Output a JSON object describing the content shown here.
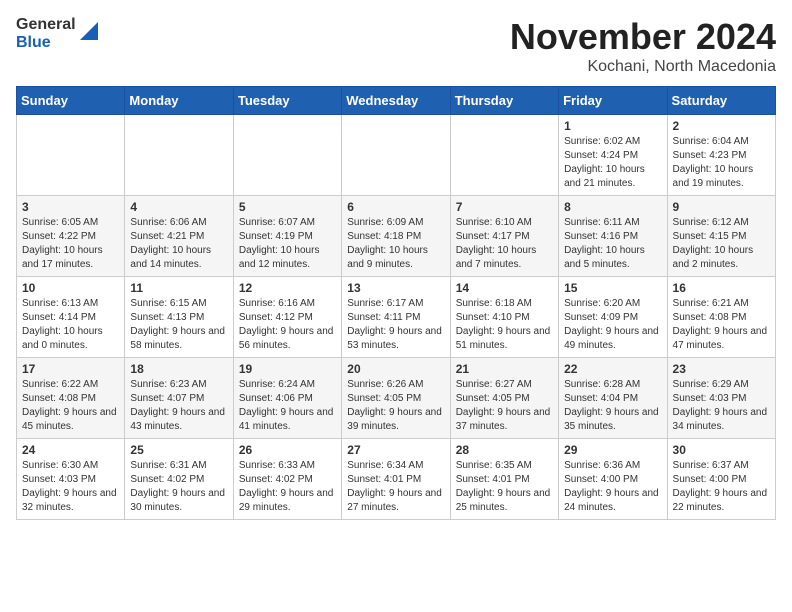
{
  "logo": {
    "text_general": "General",
    "text_blue": "Blue"
  },
  "title": {
    "month": "November 2024",
    "location": "Kochani, North Macedonia"
  },
  "days_of_week": [
    "Sunday",
    "Monday",
    "Tuesday",
    "Wednesday",
    "Thursday",
    "Friday",
    "Saturday"
  ],
  "weeks": [
    [
      {
        "day": "",
        "info": ""
      },
      {
        "day": "",
        "info": ""
      },
      {
        "day": "",
        "info": ""
      },
      {
        "day": "",
        "info": ""
      },
      {
        "day": "",
        "info": ""
      },
      {
        "day": "1",
        "info": "Sunrise: 6:02 AM\nSunset: 4:24 PM\nDaylight: 10 hours and 21 minutes."
      },
      {
        "day": "2",
        "info": "Sunrise: 6:04 AM\nSunset: 4:23 PM\nDaylight: 10 hours and 19 minutes."
      }
    ],
    [
      {
        "day": "3",
        "info": "Sunrise: 6:05 AM\nSunset: 4:22 PM\nDaylight: 10 hours and 17 minutes."
      },
      {
        "day": "4",
        "info": "Sunrise: 6:06 AM\nSunset: 4:21 PM\nDaylight: 10 hours and 14 minutes."
      },
      {
        "day": "5",
        "info": "Sunrise: 6:07 AM\nSunset: 4:19 PM\nDaylight: 10 hours and 12 minutes."
      },
      {
        "day": "6",
        "info": "Sunrise: 6:09 AM\nSunset: 4:18 PM\nDaylight: 10 hours and 9 minutes."
      },
      {
        "day": "7",
        "info": "Sunrise: 6:10 AM\nSunset: 4:17 PM\nDaylight: 10 hours and 7 minutes."
      },
      {
        "day": "8",
        "info": "Sunrise: 6:11 AM\nSunset: 4:16 PM\nDaylight: 10 hours and 5 minutes."
      },
      {
        "day": "9",
        "info": "Sunrise: 6:12 AM\nSunset: 4:15 PM\nDaylight: 10 hours and 2 minutes."
      }
    ],
    [
      {
        "day": "10",
        "info": "Sunrise: 6:13 AM\nSunset: 4:14 PM\nDaylight: 10 hours and 0 minutes."
      },
      {
        "day": "11",
        "info": "Sunrise: 6:15 AM\nSunset: 4:13 PM\nDaylight: 9 hours and 58 minutes."
      },
      {
        "day": "12",
        "info": "Sunrise: 6:16 AM\nSunset: 4:12 PM\nDaylight: 9 hours and 56 minutes."
      },
      {
        "day": "13",
        "info": "Sunrise: 6:17 AM\nSunset: 4:11 PM\nDaylight: 9 hours and 53 minutes."
      },
      {
        "day": "14",
        "info": "Sunrise: 6:18 AM\nSunset: 4:10 PM\nDaylight: 9 hours and 51 minutes."
      },
      {
        "day": "15",
        "info": "Sunrise: 6:20 AM\nSunset: 4:09 PM\nDaylight: 9 hours and 49 minutes."
      },
      {
        "day": "16",
        "info": "Sunrise: 6:21 AM\nSunset: 4:08 PM\nDaylight: 9 hours and 47 minutes."
      }
    ],
    [
      {
        "day": "17",
        "info": "Sunrise: 6:22 AM\nSunset: 4:08 PM\nDaylight: 9 hours and 45 minutes."
      },
      {
        "day": "18",
        "info": "Sunrise: 6:23 AM\nSunset: 4:07 PM\nDaylight: 9 hours and 43 minutes."
      },
      {
        "day": "19",
        "info": "Sunrise: 6:24 AM\nSunset: 4:06 PM\nDaylight: 9 hours and 41 minutes."
      },
      {
        "day": "20",
        "info": "Sunrise: 6:26 AM\nSunset: 4:05 PM\nDaylight: 9 hours and 39 minutes."
      },
      {
        "day": "21",
        "info": "Sunrise: 6:27 AM\nSunset: 4:05 PM\nDaylight: 9 hours and 37 minutes."
      },
      {
        "day": "22",
        "info": "Sunrise: 6:28 AM\nSunset: 4:04 PM\nDaylight: 9 hours and 35 minutes."
      },
      {
        "day": "23",
        "info": "Sunrise: 6:29 AM\nSunset: 4:03 PM\nDaylight: 9 hours and 34 minutes."
      }
    ],
    [
      {
        "day": "24",
        "info": "Sunrise: 6:30 AM\nSunset: 4:03 PM\nDaylight: 9 hours and 32 minutes."
      },
      {
        "day": "25",
        "info": "Sunrise: 6:31 AM\nSunset: 4:02 PM\nDaylight: 9 hours and 30 minutes."
      },
      {
        "day": "26",
        "info": "Sunrise: 6:33 AM\nSunset: 4:02 PM\nDaylight: 9 hours and 29 minutes."
      },
      {
        "day": "27",
        "info": "Sunrise: 6:34 AM\nSunset: 4:01 PM\nDaylight: 9 hours and 27 minutes."
      },
      {
        "day": "28",
        "info": "Sunrise: 6:35 AM\nSunset: 4:01 PM\nDaylight: 9 hours and 25 minutes."
      },
      {
        "day": "29",
        "info": "Sunrise: 6:36 AM\nSunset: 4:00 PM\nDaylight: 9 hours and 24 minutes."
      },
      {
        "day": "30",
        "info": "Sunrise: 6:37 AM\nSunset: 4:00 PM\nDaylight: 9 hours and 22 minutes."
      }
    ]
  ]
}
